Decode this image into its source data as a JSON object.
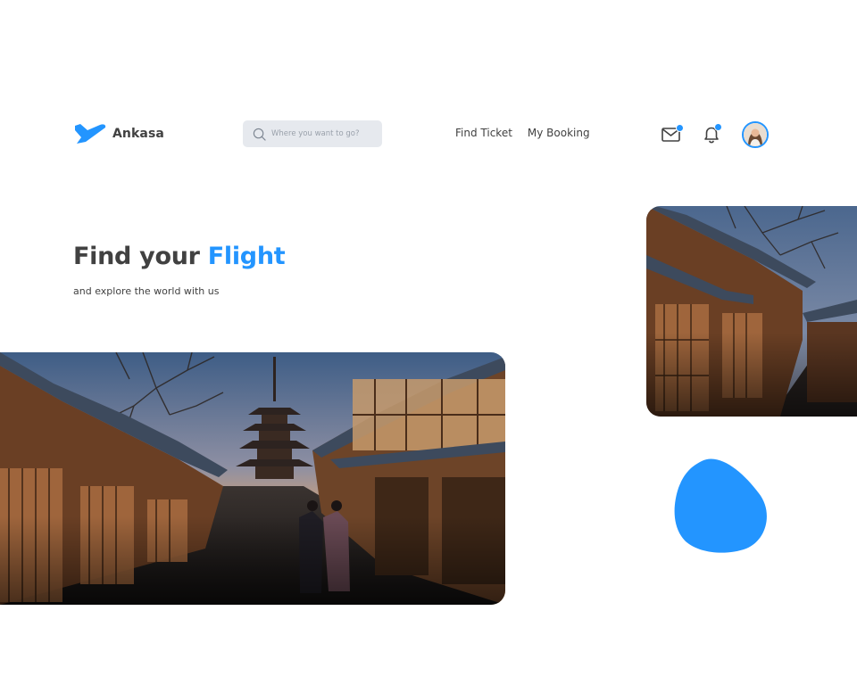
{
  "header": {
    "brand_name": "Ankasa",
    "search_placeholder": "Where you want to go?",
    "nav": [
      {
        "label": "Find Ticket"
      },
      {
        "label": "My Booking"
      }
    ],
    "icons": [
      "mail-icon",
      "bell-icon"
    ],
    "notification_dot_color": "#2395ff"
  },
  "hero": {
    "title_prefix": "Find your ",
    "title_accent": "Flight",
    "subtitle": "and explore the world with us"
  },
  "colors": {
    "accent": "#2395ff",
    "text": "#414141",
    "search_bg": "#e6e9ee"
  }
}
